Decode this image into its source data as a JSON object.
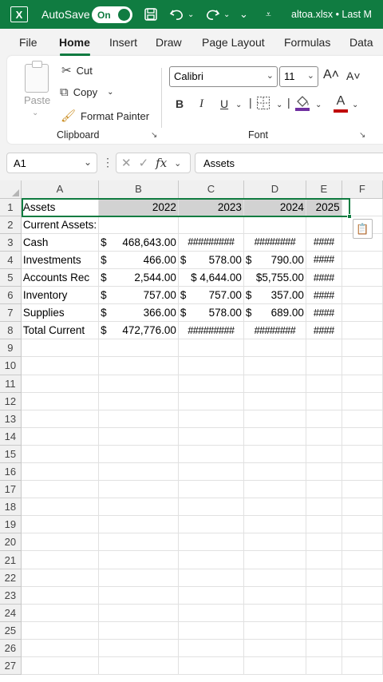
{
  "titlebar": {
    "app_logo": "X",
    "autosave_label": "AutoSave",
    "autosave_state": "On",
    "filename": "altoa.xlsx • Last M",
    "icons": [
      "save-icon",
      "undo-icon",
      "redo-icon",
      "customize-quick-access-icon"
    ]
  },
  "ribbon_tabs": [
    "File",
    "Home",
    "Insert",
    "Draw",
    "Page Layout",
    "Formulas",
    "Data"
  ],
  "active_tab": "Home",
  "clipboard": {
    "paste": "Paste",
    "cut": "Cut",
    "copy": "Copy",
    "format_painter": "Format Painter",
    "group_label": "Clipboard"
  },
  "font": {
    "name": "Calibri",
    "size": "11",
    "grow": "A˄",
    "shrink": "A˅",
    "bold": "B",
    "italic": "I",
    "underline": "U",
    "font_color_letter": "A",
    "group_label": "Font"
  },
  "formula_bar": {
    "name_box": "A1",
    "value": "Assets"
  },
  "columns": [
    "A",
    "B",
    "C",
    "D",
    "E",
    "F"
  ],
  "accent": "#107c41",
  "rows": [
    {
      "n": "1",
      "a": "Assets",
      "b": "2022",
      "c": "2023",
      "d": "2024",
      "e": "2025"
    },
    {
      "n": "2",
      "a": "Current Assets:"
    },
    {
      "n": "3",
      "a": "Cash",
      "b_sym": "$",
      "b": "468,643.00",
      "c": "#########",
      "d": "########",
      "e": "####"
    },
    {
      "n": "4",
      "a": "Investments",
      "b_sym": "$",
      "b": "466.00",
      "c_sym": "$",
      "c": "578.00",
      "d_sym": "$",
      "d": "790.00",
      "e": "####"
    },
    {
      "n": "5",
      "a": "Accounts Rec",
      "b_sym": "$",
      "b": "2,544.00",
      "c": "$ 4,644.00",
      "d": "$5,755.00",
      "e": "####"
    },
    {
      "n": "6",
      "a": "Inventory",
      "b_sym": "$",
      "b": "757.00",
      "c_sym": "$",
      "c": "757.00",
      "d_sym": "$",
      "d": "357.00",
      "e": "####"
    },
    {
      "n": "7",
      "a": "Supplies",
      "b_sym": "$",
      "b": "366.00",
      "c_sym": "$",
      "c": "578.00",
      "d_sym": "$",
      "d": "689.00",
      "e": "####"
    },
    {
      "n": "8",
      "a": "Total Current",
      "b_sym": "$",
      "b": "472,776.00",
      "c": "#########",
      "d": "########",
      "e": "####"
    },
    {
      "n": "9"
    },
    {
      "n": "10"
    },
    {
      "n": "11"
    },
    {
      "n": "12"
    },
    {
      "n": "13"
    },
    {
      "n": "14"
    },
    {
      "n": "15"
    },
    {
      "n": "16"
    },
    {
      "n": "17"
    },
    {
      "n": "18"
    },
    {
      "n": "19"
    },
    {
      "n": "20"
    },
    {
      "n": "21"
    },
    {
      "n": "22"
    },
    {
      "n": "23"
    },
    {
      "n": "24"
    },
    {
      "n": "25"
    },
    {
      "n": "26"
    },
    {
      "n": "27"
    }
  ]
}
